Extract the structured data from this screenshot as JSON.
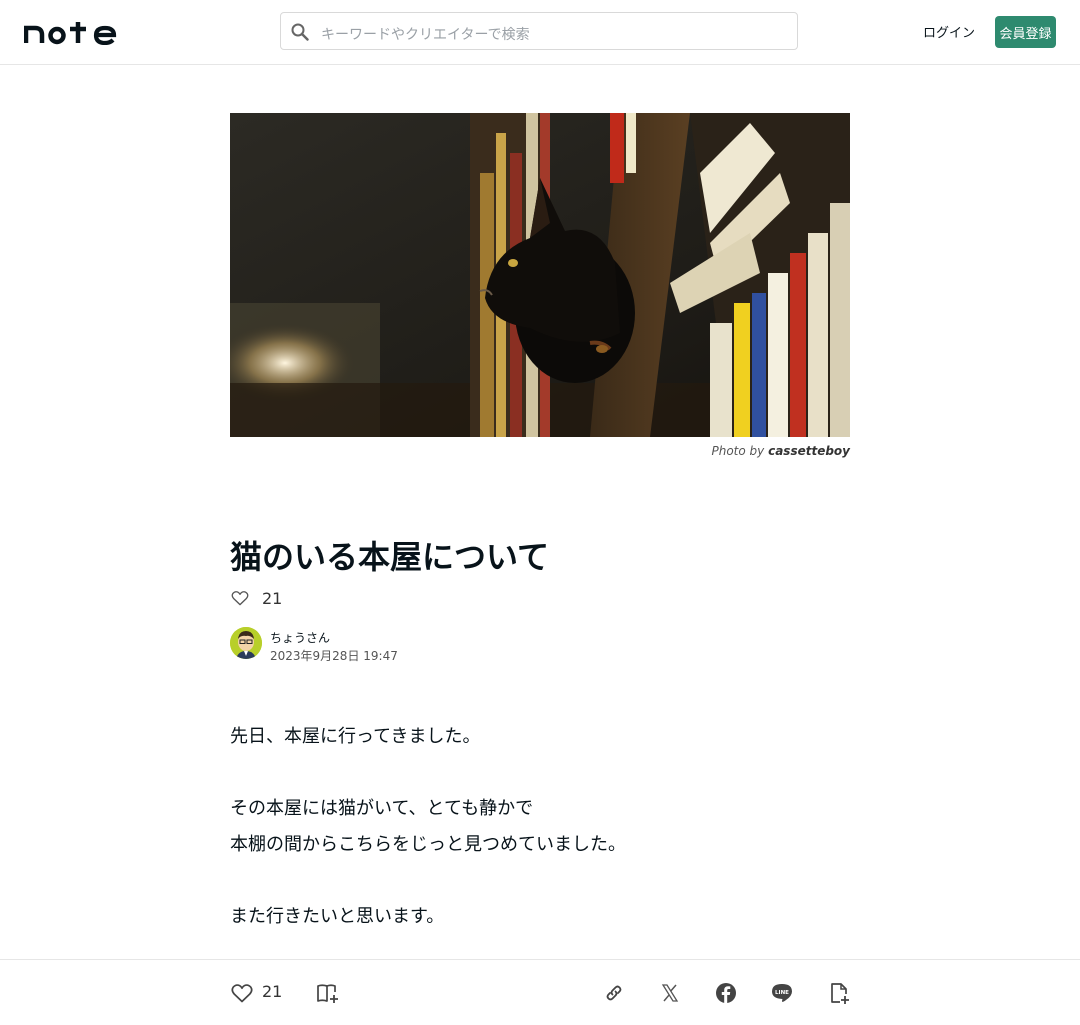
{
  "header": {
    "logo_text": "note",
    "search_placeholder": "キーワードやクリエイターで検索",
    "login_label": "ログイン",
    "signup_label": "会員登録"
  },
  "hero": {
    "credit_prefix": "Photo by",
    "credit_author": "cassetteboy"
  },
  "article": {
    "title": "猫のいる本屋について",
    "like_count": "21",
    "author_name": "ちょうさん",
    "published": "2023年9月28日 19:47",
    "body": [
      "先日、本屋に行ってきました。",
      "その本屋には猫がいて、とても静かで",
      "本棚の間からこちらをじっと見つめていました。",
      "また行きたいと思います。"
    ]
  },
  "bottom_bar": {
    "like_count": "21",
    "icons": [
      "heart-icon",
      "magazine-add-icon",
      "link-icon",
      "x-icon",
      "facebook-icon",
      "line-icon",
      "note-add-icon"
    ]
  },
  "colors": {
    "brand_green": "#2e8a6f",
    "text": "#08131a"
  }
}
